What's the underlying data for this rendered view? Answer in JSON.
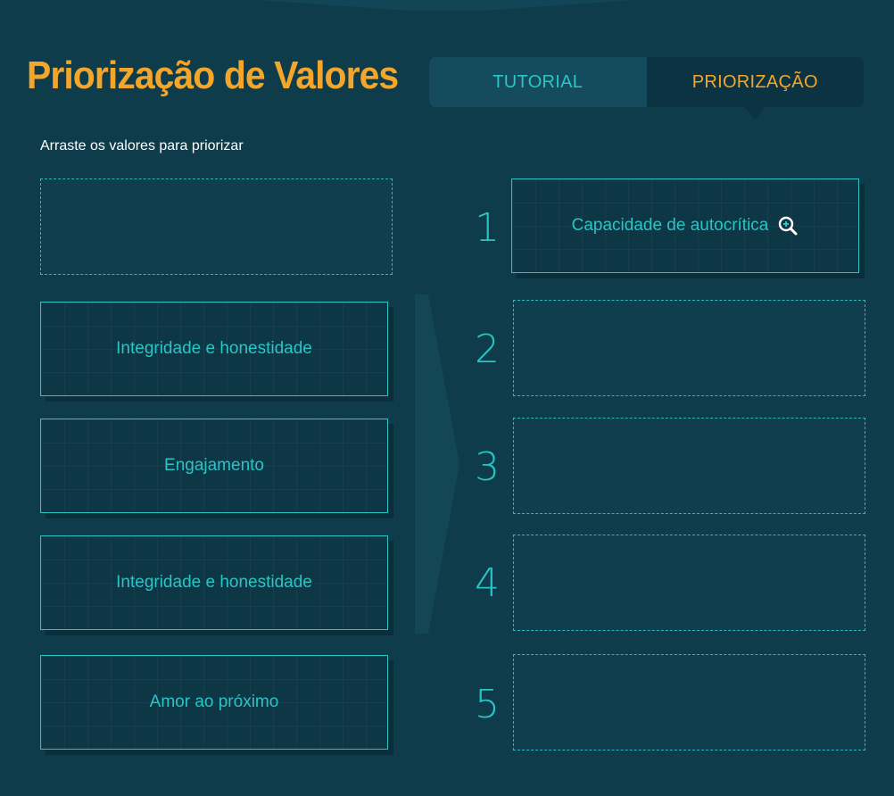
{
  "header": {
    "title": "Priorização de Valores",
    "tabs": [
      {
        "label": "TUTORIAL",
        "active": false
      },
      {
        "label": "PRIORIZAÇÃO",
        "active": true
      }
    ]
  },
  "instruction": "Arraste os valores para priorizar",
  "source_cards": [
    {
      "label": ""
    },
    {
      "label": "Integridade e honestidade"
    },
    {
      "label": "Engajamento"
    },
    {
      "label": "Integridade e honestidade"
    },
    {
      "label": "Amor ao próximo"
    }
  ],
  "ranking": [
    {
      "number": "1",
      "label": "Capacidade de autocrítica",
      "icon": "zoom-in-icon"
    },
    {
      "number": "2",
      "label": ""
    },
    {
      "number": "3",
      "label": ""
    },
    {
      "number": "4",
      "label": ""
    },
    {
      "number": "5",
      "label": ""
    }
  ],
  "colors": {
    "background": "#0f3c4b",
    "accent_orange": "#f4a62a",
    "accent_cyan": "#2bc4c6"
  }
}
